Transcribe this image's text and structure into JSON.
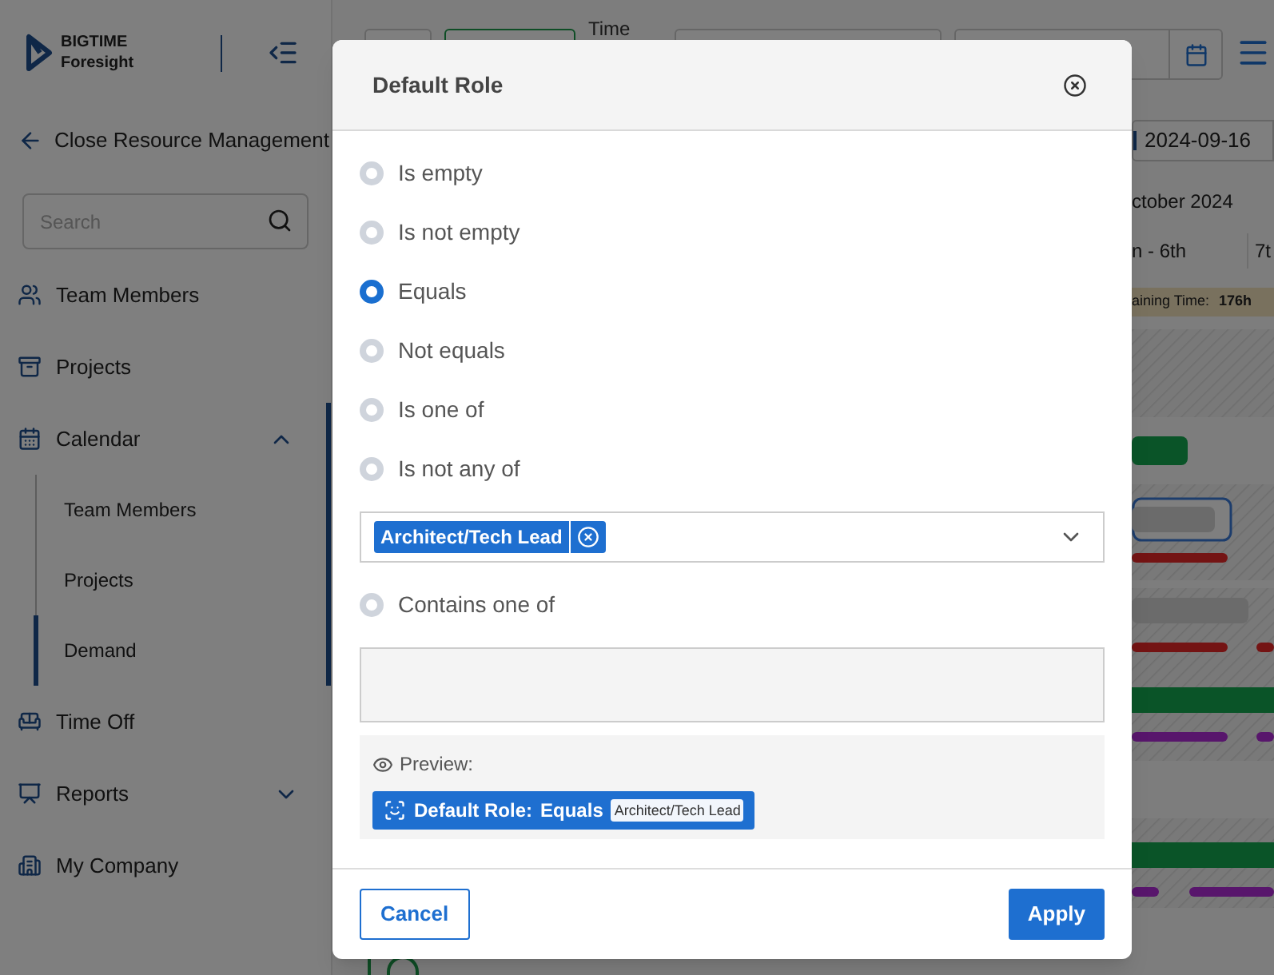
{
  "sidebar": {
    "logo": {
      "line_1": "BIGTIME",
      "line_2": "Foresight"
    },
    "back_link": "Close Resource Management",
    "search": {
      "placeholder": "Search"
    },
    "items": [
      {
        "label": "Team Members",
        "selected": false
      },
      {
        "label": "Projects",
        "selected": false
      },
      {
        "label": "Calendar",
        "selected": true,
        "expanded": true,
        "children": [
          {
            "label": "Team Members",
            "selected": false
          },
          {
            "label": "Projects",
            "selected": false
          },
          {
            "label": "Demand",
            "selected": true
          }
        ]
      },
      {
        "label": "Time Off",
        "selected": false
      },
      {
        "label": "Reports",
        "selected": false,
        "expanded": false
      },
      {
        "label": "My Company",
        "selected": false
      }
    ]
  },
  "toolbar": {
    "toggle_on": true,
    "label": "Time"
  },
  "schedule": {
    "date_field": "2024-09-16",
    "month": "ctober 2024",
    "weeks": [
      "n - 6th",
      "7t"
    ],
    "remaining": {
      "label": "aining Time:",
      "value": "176h"
    }
  },
  "dialog": {
    "title": "Default Role",
    "options": [
      {
        "kind": "radio",
        "label": "Is empty",
        "selected": false
      },
      {
        "kind": "radio",
        "label": "Is not empty",
        "selected": false
      },
      {
        "kind": "radio",
        "label": "Equals",
        "selected": true
      },
      {
        "kind": "radio",
        "label": "Not equals",
        "selected": false
      },
      {
        "kind": "radio",
        "label": "Is one of",
        "selected": false
      },
      {
        "kind": "radio",
        "label": "Is not any of",
        "selected": false
      },
      {
        "kind": "tag_select",
        "tags": [
          "Architect/Tech Lead"
        ]
      },
      {
        "kind": "radio",
        "label": "Contains one of",
        "selected": false
      },
      {
        "kind": "text_area"
      }
    ],
    "preview": {
      "label": "Preview:",
      "field": "Default Role:",
      "operator": "Equals",
      "value": "Architect/Tech Lead"
    },
    "buttons": [
      {
        "label": "Cancel",
        "kind": "secondary"
      },
      {
        "label": "Apply",
        "kind": "primary"
      }
    ]
  }
}
